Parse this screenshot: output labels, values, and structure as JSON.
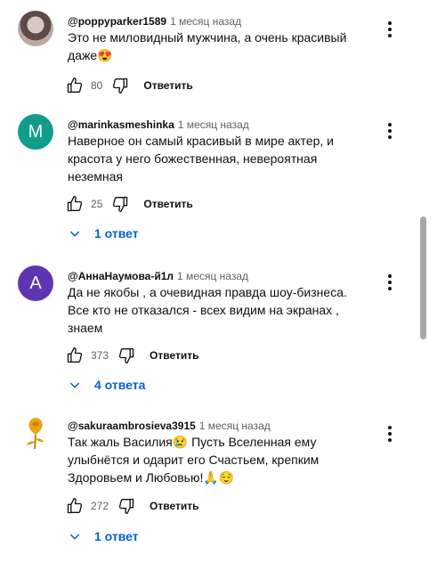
{
  "comments": [
    {
      "author": "@poppyparker1589",
      "time": "1 месяц назад",
      "text": "Это не миловидный мужчина, а очень красивый даже😍",
      "likes": "80",
      "reply_label": "Ответить"
    },
    {
      "author": "@marinkasmeshinka",
      "time": "1 месяц назад",
      "avatar_letter": "M",
      "text": "Наверное он самый красивый в мире актер, и красота у него божественная, невероятная неземная",
      "likes": "25",
      "reply_label": "Ответить",
      "replies": "1 ответ"
    },
    {
      "author": "@АннаНаумова-й1л",
      "time": "1 месяц назад",
      "avatar_letter": "А",
      "text": "Да не якобы , а очевидная правда шоу-бизнеса. Все кто не отказался - всех видим на экранах , знаем",
      "likes": "373",
      "reply_label": "Ответить",
      "replies": "4 ответа"
    },
    {
      "author": "@sakuraambrosieva3915",
      "time": "1 месяц назад",
      "text": "Так жаль Василия😢  Пусть Вселенная ему улыбнётся и одарит его Счастьем, крепким Здоровьем и Любовью!🙏😌",
      "likes": "272",
      "reply_label": "Ответить",
      "replies": "1 ответ"
    }
  ],
  "colors": {
    "avatar_m": "#0f9d8a",
    "avatar_a": "#5e35b1",
    "link": "#065fd4"
  },
  "icons": [
    "like-icon",
    "dislike-icon",
    "more-vert-icon",
    "chevron-down-icon"
  ]
}
